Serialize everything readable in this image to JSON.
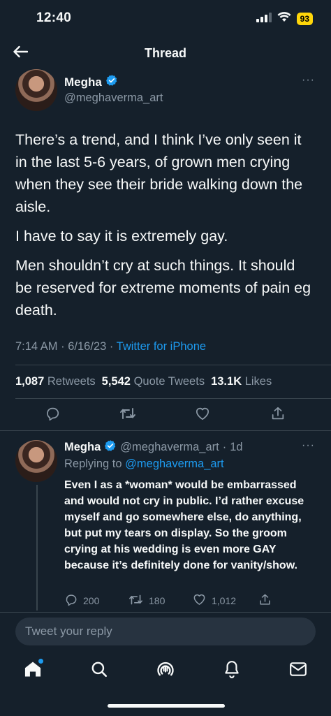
{
  "status_bar": {
    "time": "12:40",
    "battery": "93"
  },
  "header": {
    "title": "Thread"
  },
  "tweet": {
    "author_name": "Megha",
    "handle": "@meghaverma_art",
    "paragraphs": [
      "There’s a trend, and I think I’ve only seen it in the last 5-6 years, of grown men crying when they see their bride walking down the aisle.",
      "I have to say it is extremely gay.",
      "Men shouldn’t cry at such things. It should be reserved for extreme moments of pain eg death."
    ],
    "time": "7:14 AM",
    "date": "6/16/23",
    "source": "Twitter for iPhone",
    "stats": {
      "retweets_count": "1,087",
      "retweets_label": "Retweets",
      "quotes_count": "5,542",
      "quotes_label": "Quote Tweets",
      "likes_count": "13.1K",
      "likes_label": "Likes"
    }
  },
  "reply": {
    "author_name": "Megha",
    "handle": "@meghaverma_art",
    "age": "1d",
    "replying_label": "Replying to",
    "replying_to": "@meghaverma_art",
    "text": "Even I as a *woman* would be embarrassed and would not cry in public. I’d rather excuse myself and go somewhere else, do anything, but put my tears on display. So the groom crying at his wedding is even more GAY because it’s definitely done for vanity/show.",
    "replies": "200",
    "retweets": "180",
    "likes": "1,012"
  },
  "composer": {
    "placeholder": "Tweet your reply"
  },
  "colors": {
    "background": "#15202b",
    "accent": "#1d9bf0",
    "muted": "#8b98a5",
    "divider": "#38444d",
    "battery": "#ffd60a"
  },
  "icons": [
    "back-arrow-icon",
    "verified-icon",
    "more-icon",
    "reply-icon",
    "retweet-icon",
    "like-icon",
    "share-icon",
    "home-icon",
    "search-icon",
    "spaces-icon",
    "notifications-icon",
    "messages-icon",
    "signal-icon",
    "wifi-icon"
  ]
}
